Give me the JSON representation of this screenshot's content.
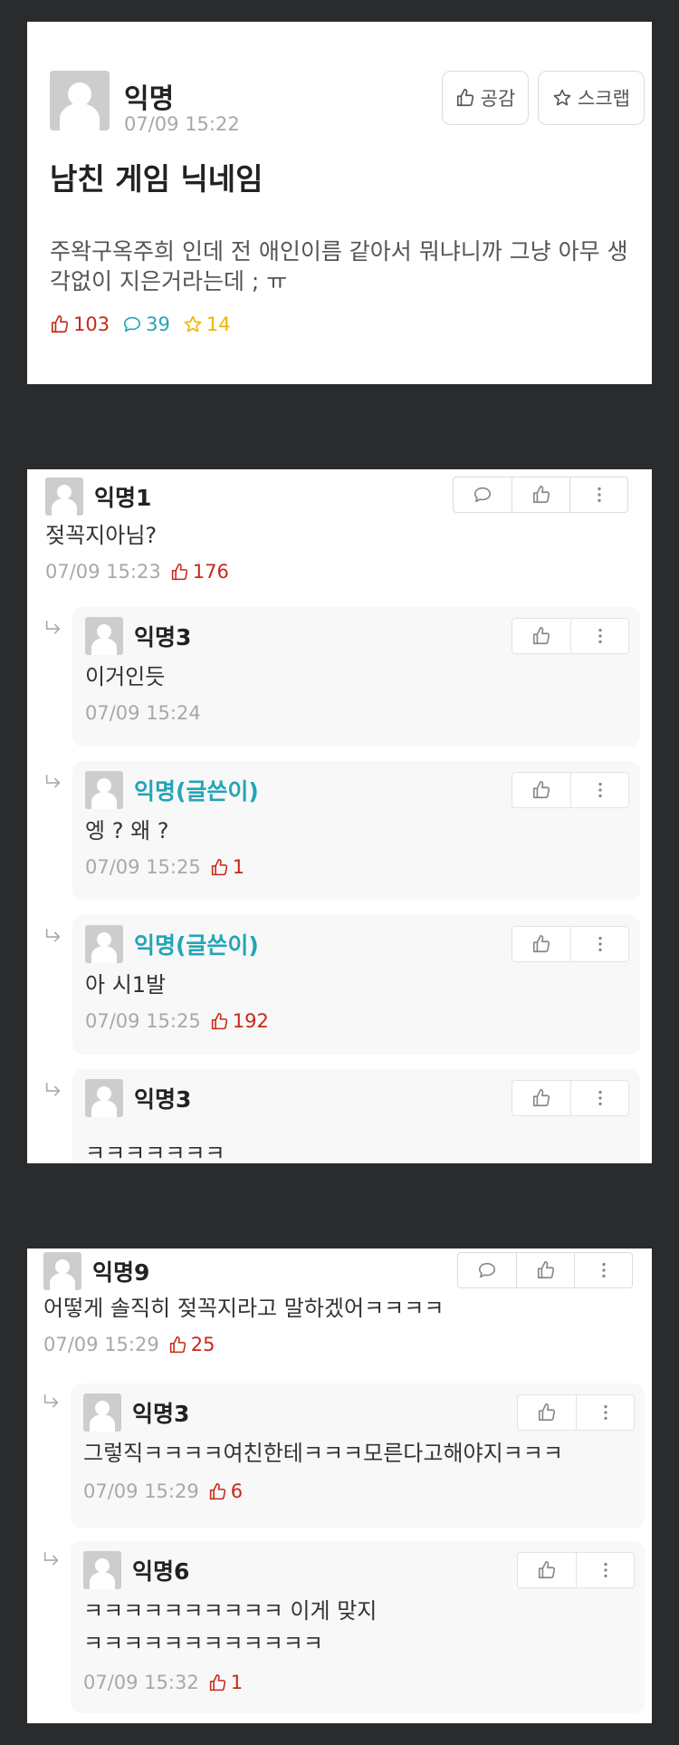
{
  "post": {
    "author": "익명",
    "time": "07/09 15:22",
    "like_label": "공감",
    "scrap_label": "스크랩",
    "title": "남친 게임 닉네임",
    "body": "주왁구옥주희 인데 전 애인이름 같아서 뭐냐니까 그냥 아무 생각없이 지은거라는데 ; ㅠ",
    "likes": "103",
    "comments": "39",
    "scraps": "14"
  },
  "thread1": {
    "author": "익명1",
    "text": "젖꼭지아님?",
    "time": "07/09 15:23",
    "votes": "176",
    "replies": [
      {
        "author": "익명3",
        "text": "이거인듯",
        "time": "07/09 15:24",
        "votes": ""
      },
      {
        "author": "익명(글쓴이)",
        "text": "엥 ? 왜 ?",
        "time": "07/09 15:25",
        "votes": "1"
      },
      {
        "author": "익명(글쓴이)",
        "text": "아 시1발",
        "time": "07/09 15:25",
        "votes": "192"
      },
      {
        "author": "익명3",
        "text": "ㅋㅋㅋㅋㅋㅋㅋ",
        "time": "",
        "votes": ""
      }
    ]
  },
  "thread2": {
    "author": "익명9",
    "text": "어떻게 솔직히 젖꼭지라고 말하겠어ㅋㅋㅋㅋ",
    "time": "07/09 15:29",
    "votes": "25",
    "replies": [
      {
        "author": "익명3",
        "text": "그렇직ㅋㅋㅋㅋ여친한테ㅋㅋㅋ모른다고해야지ㅋㅋㅋ",
        "time": "07/09 15:29",
        "votes": "6"
      },
      {
        "author": "익명6",
        "text_line1": "ㅋㅋㅋㅋㅋㅋㅋㅋㅋㅋ 이게 맞지",
        "text_line2": "ㅋㅋㅋㅋㅋㅋㅋㅋㅋㅋㅋㅋ",
        "time": "07/09 15:32",
        "votes": "1"
      }
    ]
  },
  "colors": {
    "background": "#2a2b2d",
    "vote_red": "#c62917",
    "writer_teal": "#23a5b7",
    "scrap_yellow": "#f0b400",
    "muted": "#a8a8a8"
  },
  "icons": [
    "thumbs-up-icon",
    "star-icon",
    "speech-bubble-icon",
    "more-vertical-icon",
    "reply-arrow-icon",
    "avatar-icon"
  ]
}
